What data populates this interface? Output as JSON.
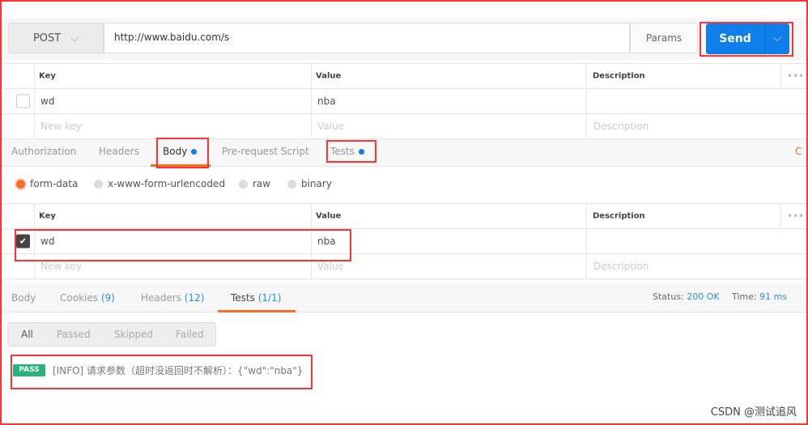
{
  "request": {
    "method": "POST",
    "url": "http://www.baidu.com/s",
    "params_label": "Params",
    "send_label": "Send"
  },
  "params_table": {
    "headers": [
      "Key",
      "Value",
      "Description"
    ],
    "rows": [
      {
        "key": "wd",
        "value": "nba"
      }
    ],
    "placeholders": {
      "key": "New key",
      "value": "Value",
      "description": "Description"
    }
  },
  "request_tabs": [
    {
      "label": "Authorization"
    },
    {
      "label": "Headers"
    },
    {
      "label": "Body"
    },
    {
      "label": "Pre-request Script"
    },
    {
      "label": "Tests"
    }
  ],
  "cut_text": "C",
  "body_modes": [
    "form-data",
    "x-www-form-urlencoded",
    "raw",
    "binary"
  ],
  "body_table": {
    "headers": [
      "Key",
      "Value",
      "Description"
    ],
    "rows": [
      {
        "key": "wd",
        "value": "nba",
        "checked": true
      }
    ],
    "placeholders": {
      "key": "New key",
      "value": "Value",
      "description": "Description"
    }
  },
  "response_tabs": [
    {
      "label": "Body",
      "count": ""
    },
    {
      "label": "Cookies",
      "count": "(9)"
    },
    {
      "label": "Headers",
      "count": "(12)"
    },
    {
      "label": "Tests",
      "count": "(1/1)"
    }
  ],
  "status": {
    "status_label": "Status:",
    "status_value": "200 OK",
    "time_label": "Time:",
    "time_value": "91 ms"
  },
  "filters": [
    "All",
    "Passed",
    "Skipped",
    "Failed"
  ],
  "test_result": {
    "badge": "PASS",
    "text": "[INFO] 请求参数（超时没返回时不解析）：{\"wd\":\"nba\"}"
  },
  "watermark": "CSDN @测试追风",
  "colors": {
    "accent": "#0e7ee8",
    "active_tab": "#f47023",
    "pass": "#26b47b",
    "annotation": "#ff3333"
  }
}
